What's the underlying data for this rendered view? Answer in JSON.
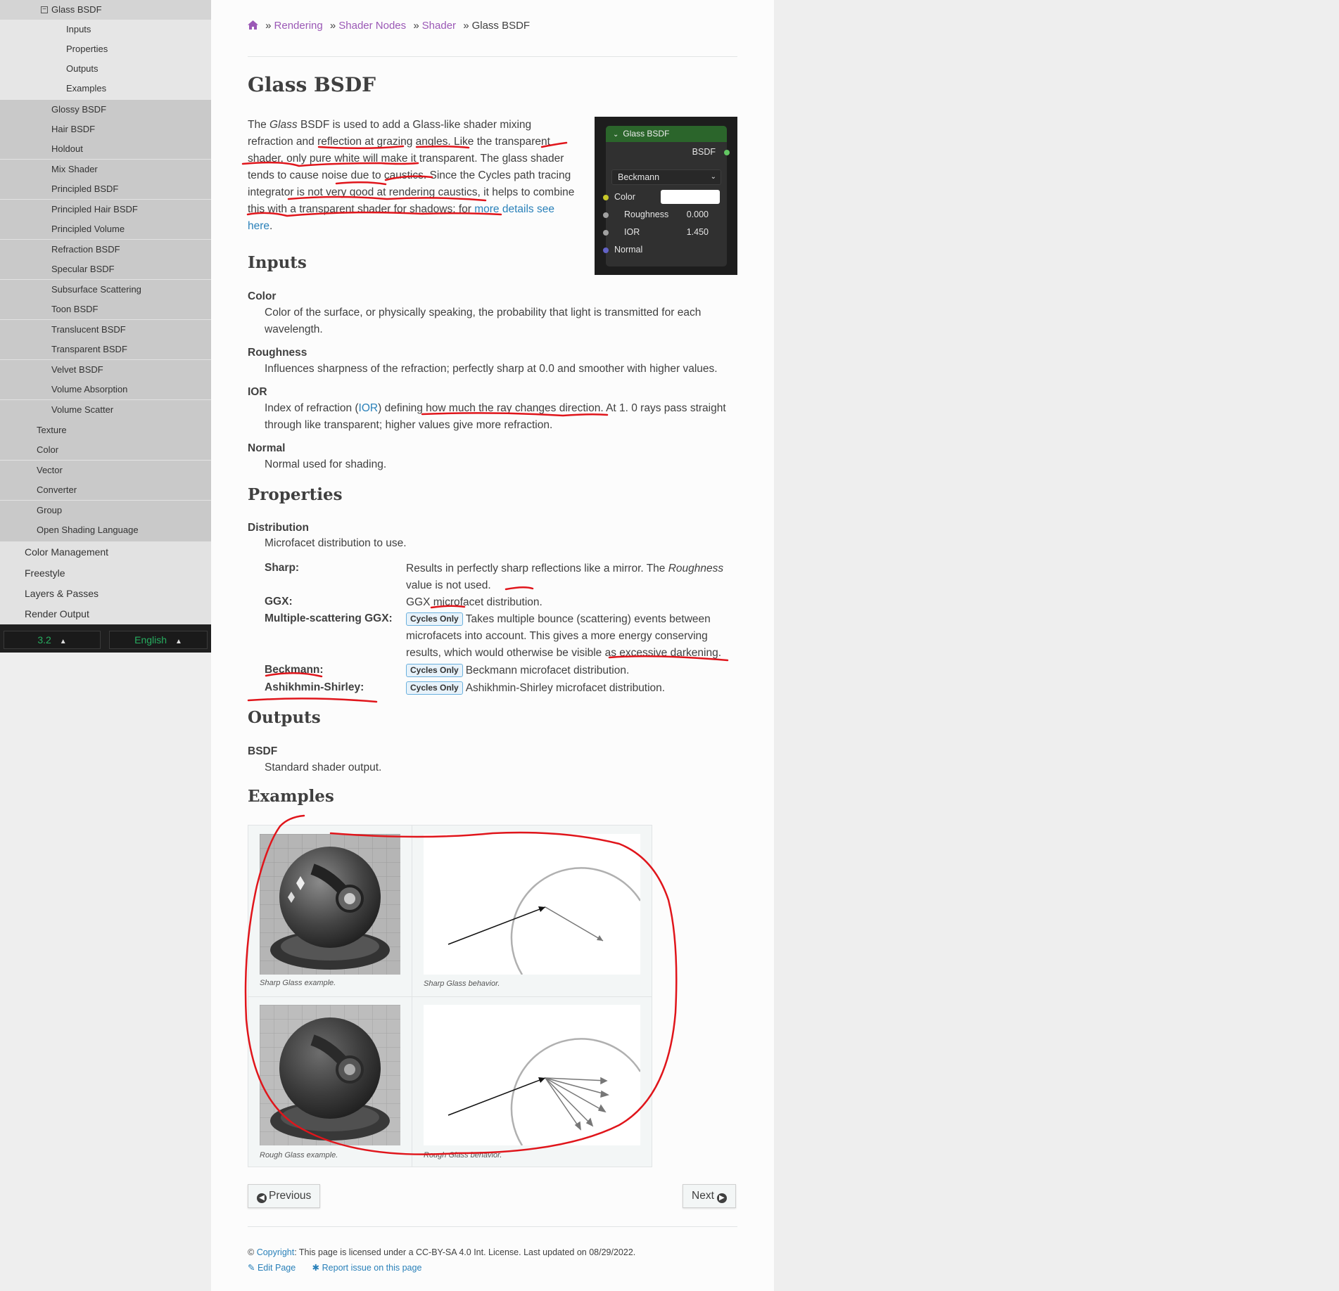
{
  "sidebar": {
    "items": [
      {
        "label": "Glass BSDF",
        "toggle": "⊟"
      },
      {
        "label": "Inputs"
      },
      {
        "label": "Properties"
      },
      {
        "label": "Outputs"
      },
      {
        "label": "Examples"
      },
      {
        "label": "Glossy BSDF"
      },
      {
        "label": "Hair BSDF"
      },
      {
        "label": "Holdout"
      },
      {
        "label": "Mix Shader"
      },
      {
        "label": "Principled BSDF"
      },
      {
        "label": "Principled Hair BSDF"
      },
      {
        "label": "Principled Volume"
      },
      {
        "label": "Refraction BSDF"
      },
      {
        "label": "Specular BSDF"
      },
      {
        "label": "Subsurface Scattering"
      },
      {
        "label": "Toon BSDF"
      },
      {
        "label": "Translucent BSDF"
      },
      {
        "label": "Transparent BSDF"
      },
      {
        "label": "Velvet BSDF"
      },
      {
        "label": "Volume Absorption"
      },
      {
        "label": "Volume Scatter"
      },
      {
        "label": "Texture"
      },
      {
        "label": "Color"
      },
      {
        "label": "Vector"
      },
      {
        "label": "Converter"
      },
      {
        "label": "Group"
      },
      {
        "label": "Open Shading Language"
      },
      {
        "label": "Color Management"
      },
      {
        "label": "Freestyle"
      },
      {
        "label": "Layers & Passes"
      },
      {
        "label": "Render Output"
      }
    ],
    "version": "3.2",
    "language": "English",
    "caret": "▲"
  },
  "breadcrumb": {
    "home_icon": "home-icon",
    "sep": "»",
    "items": [
      "Rendering",
      "Shader Nodes",
      "Shader"
    ],
    "current": "Glass BSDF"
  },
  "page": {
    "title": "Glass BSDF",
    "intro": {
      "p1": "The ",
      "em": "Glass",
      "p2": " BSDF is used to add a Glass-like shader mixing refraction and reflection at grazing angles. Like the transparent shader, only pure white will make it transparent. The glass shader tends to cause noise due to caustics. Since the Cycles path tracing integrator is not very good at rendering caustics, it helps to combine this with a transparent shader for shadows; for ",
      "link": "more details see here",
      "p3": "."
    }
  },
  "node": {
    "title": "Glass BSDF",
    "output": "BSDF",
    "distribution": "Beckmann",
    "color_label": "Color",
    "roughness_label": "Roughness",
    "roughness_value": "0.000",
    "ior_label": "IOR",
    "ior_value": "1.450",
    "normal_label": "Normal",
    "header_color": "#2b652b",
    "socket_colors": {
      "shader": "#63c763",
      "color": "#c7c729",
      "value": "#a1a1a1",
      "vector": "#6363c7"
    }
  },
  "inputs": {
    "heading": "Inputs",
    "color_term": "Color",
    "color_def": "Color of the surface, or physically speaking, the probability that light is transmitted for each wavelength.",
    "roughness_term": "Roughness",
    "roughness_def": "Influences sharpness of the refraction; perfectly sharp at 0.0 and smoother with higher values.",
    "ior_term": "IOR",
    "ior_def_1": "Index of refraction (",
    "ior_link": "IOR",
    "ior_def_2": ") defining how much the ray changes direction. At 1. 0 rays pass straight through like transparent; higher values give more refraction.",
    "normal_term": "Normal",
    "normal_def": "Normal used for shading."
  },
  "properties": {
    "heading": "Properties",
    "distribution_term": "Distribution",
    "distribution_def": "Microfacet distribution to use.",
    "badge": "Cycles Only",
    "options": [
      {
        "term": "Sharp:",
        "def_1": "Results in perfectly sharp reflections like a mirror. The ",
        "def_em": "Roughness",
        "def_2": " value is not used."
      },
      {
        "term": "GGX:",
        "def": "GGX microfacet distribution."
      },
      {
        "term": "Multiple-scattering GGX:",
        "def": "Takes multiple bounce (scattering) events between microfacets into account. This gives a more energy conserving results, which would otherwise be visible as excessive darkening."
      },
      {
        "term": "Beckmann:",
        "def": "Beckmann microfacet distribution."
      },
      {
        "term": "Ashikhmin-Shirley:",
        "def": "Ashikhmin-Shirley microfacet distribution."
      }
    ]
  },
  "outputs": {
    "heading": "Outputs",
    "bsdf_term": "BSDF",
    "bsdf_def": "Standard shader output."
  },
  "examples": {
    "heading": "Examples",
    "captions": [
      "Sharp Glass example.",
      "Sharp Glass behavior.",
      "Rough Glass example.",
      "Rough Glass behavior."
    ]
  },
  "nav": {
    "previous": "Previous",
    "next": "Next"
  },
  "footer": {
    "copyright_symbol": "©",
    "copyright_link": "Copyright",
    "license_text": ": This page is licensed under a CC-BY-SA 4.0 Int. License. Last updated on 08/29/2022.",
    "edit": "Edit Page",
    "report": "Report issue on this page"
  },
  "colors": {
    "link": "#2980b9",
    "breadcrumb_link": "#9b59b6",
    "annotation": "#e0151b",
    "version_text": "#27ae60"
  }
}
